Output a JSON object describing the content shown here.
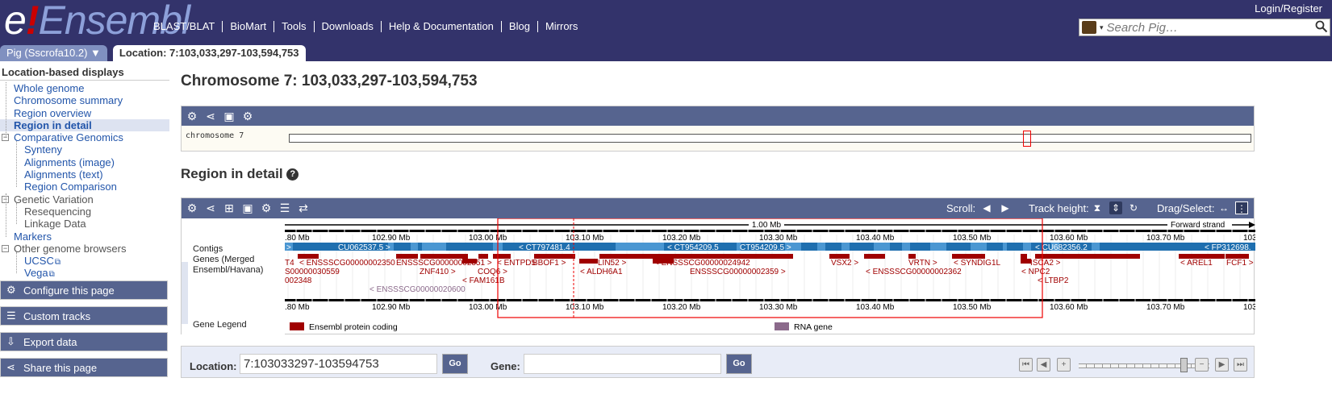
{
  "header": {
    "logo_e": "e",
    "logo_bang": "!",
    "logo_text": "Ensembl",
    "login": "Login/Register",
    "search_placeholder": "Search Pig…",
    "nav": [
      "BLAST/BLAT",
      "BioMart",
      "Tools",
      "Downloads",
      "Help & Documentation",
      "Blog",
      "Mirrors"
    ]
  },
  "tabs": {
    "species": "Pig (Sscrofa10.2) ▼",
    "location": "Location: 7:103,033,297-103,594,753"
  },
  "sidebar": {
    "heading": "Location-based displays",
    "items": [
      {
        "label": "Whole genome",
        "level": 0,
        "link": true
      },
      {
        "label": "Chromosome summary",
        "level": 0,
        "link": true
      },
      {
        "label": "Region overview",
        "level": 0,
        "link": true
      },
      {
        "label": "Region in detail",
        "level": 0,
        "link": true,
        "selected": true
      },
      {
        "label": "Comparative Genomics",
        "level": 0,
        "link": true,
        "box": "−"
      },
      {
        "label": "Synteny",
        "level": 1,
        "link": true
      },
      {
        "label": "Alignments (image)",
        "level": 1,
        "link": true
      },
      {
        "label": "Alignments (text)",
        "level": 1,
        "link": true
      },
      {
        "label": "Region Comparison",
        "level": 1,
        "link": true
      },
      {
        "label": "Genetic Variation",
        "level": 0,
        "link": false,
        "box": "−"
      },
      {
        "label": "Resequencing",
        "level": 1,
        "link": false
      },
      {
        "label": "Linkage Data",
        "level": 1,
        "link": false
      },
      {
        "label": "Markers",
        "level": 0,
        "link": true
      },
      {
        "label": "Other genome browsers",
        "level": 0,
        "link": false,
        "box": "−"
      },
      {
        "label": "UCSC",
        "level": 1,
        "link": true,
        "ext": true
      },
      {
        "label": "Vega",
        "level": 1,
        "link": true,
        "ext": true
      }
    ],
    "buttons": [
      "Configure this page",
      "Custom tracks",
      "Export data",
      "Share this page"
    ]
  },
  "main": {
    "title": "Chromosome 7: 103,033,297-103,594,753",
    "chr_label": "chromosome 7",
    "region_title": "Region in detail",
    "toolbar": {
      "scroll": "Scroll:",
      "track_height": "Track height:",
      "drag_select": "Drag/Select:"
    },
    "track_labels": {
      "contigs": "Contigs",
      "genes": "Genes (Merged",
      "genes2": "Ensembl/Havana)",
      "legend": "Gene Legend"
    },
    "scale_label": "1.00 Mb",
    "strand_label": "Forward strand",
    "ticks": [
      ".80 Mb",
      "102.90 Mb",
      "103.00 Mb",
      "103.10 Mb",
      "103.20 Mb",
      "103.30 Mb",
      "103.40 Mb",
      "103.50 Mb",
      "103.60 Mb",
      "103.70 Mb",
      "103"
    ],
    "contigs": [
      "CU062537.5 >",
      "< CT797481.4",
      "< CT954209.5",
      "CT954209.5 >",
      "< CU682356.2",
      "< FP312698.",
      ">"
    ],
    "gene_labels": [
      "T4",
      "< ENSSSCG00000002350",
      "ENSSSCG00000002351 >",
      "< ENTPD5",
      "BBOF1 >",
      "LIN52 >",
      "< ENSSSCG00000024942",
      "VSX2 >",
      "VRTN >",
      "< SYNDIG1L",
      "ISCA2 >",
      "< AREL1",
      "FCF1 >",
      "S00000030559",
      "ZNF410 >",
      "COQ6 >",
      "< ALDH6A1",
      "ENSSSCG00000002359 >",
      "< ENSSSCG00000002362",
      "< NPC2",
      "002348",
      "< FAM161B",
      "< LTBP2",
      "< ENSSSCG00000020600"
    ],
    "legend": {
      "protein": "Ensembl protein coding",
      "rna": "RNA gene",
      "protein_color": "#a00000",
      "rna_color": "#8b6a8b"
    }
  },
  "location_bar": {
    "location_label": "Location:",
    "location_value": "7:103033297-103594753",
    "go": "Go",
    "gene_label": "Gene:",
    "gene_value": ""
  }
}
